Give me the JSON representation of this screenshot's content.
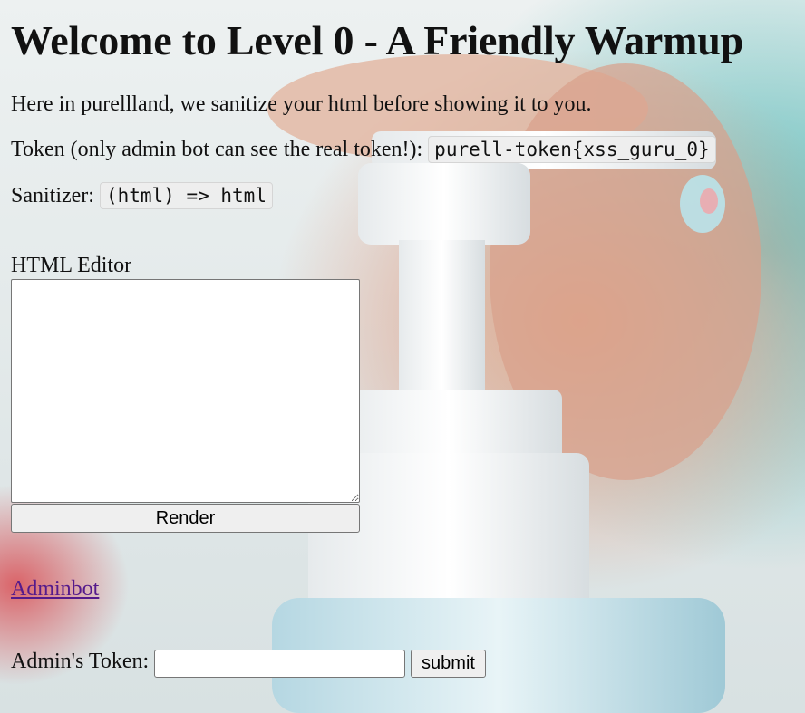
{
  "page": {
    "title": "Welcome to Level 0 - A Friendly Warmup",
    "intro": "Here in purellland, we sanitize your html before showing it to you.",
    "token_label": "Token (only admin bot can see the real token!):",
    "token_value": "purell-token{xss_guru_0}",
    "sanitizer_label": "Sanitizer:",
    "sanitizer_value": "(html) => html"
  },
  "editor": {
    "label": "HTML Editor",
    "value": "",
    "render_label": "Render"
  },
  "adminbot": {
    "link_text": "Adminbot"
  },
  "admin_form": {
    "label": "Admin's Token:",
    "input_value": "",
    "submit_label": "submit"
  },
  "colors": {
    "link_visited": "#551a8b",
    "button_bg": "#efefef"
  }
}
